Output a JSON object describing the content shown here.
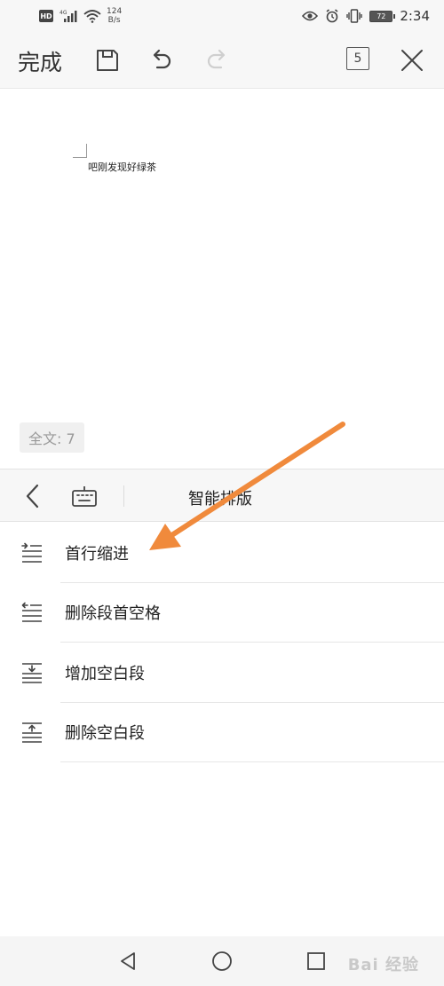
{
  "status_bar": {
    "hd_badge": "HD",
    "network_type": "4G",
    "speed_value": "124",
    "speed_unit": "B/s",
    "battery_level": "72",
    "time": "2:34"
  },
  "toolbar": {
    "done_label": "完成",
    "page_count": "5"
  },
  "document": {
    "text": "吧刚发现好绿茶",
    "word_count": "全文: 7"
  },
  "layout_panel": {
    "title": "智能排版",
    "items": [
      {
        "label": "首行缩进",
        "icon": "first-line-indent-icon"
      },
      {
        "label": "删除段首空格",
        "icon": "remove-leading-space-icon"
      },
      {
        "label": "增加空白段",
        "icon": "add-blank-paragraph-icon"
      },
      {
        "label": "删除空白段",
        "icon": "remove-blank-paragraph-icon"
      }
    ]
  },
  "watermark": "Bai 经验",
  "colors": {
    "arrow": "#f08a3c",
    "bar_bg": "#f7f7f7",
    "text": "#222222",
    "muted": "#999999"
  }
}
